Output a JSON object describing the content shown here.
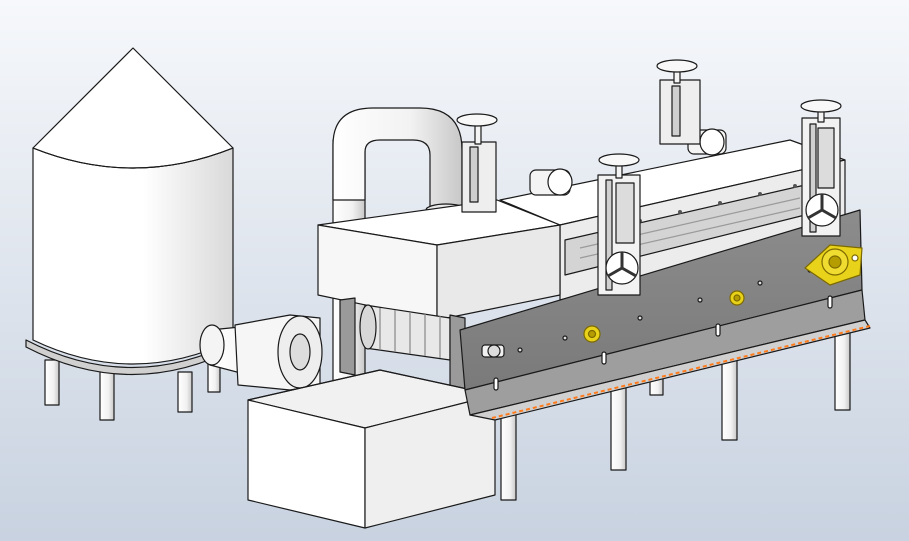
{
  "viewport": {
    "background_top": "#f6f8fb",
    "background_bottom": "#c8d2e0"
  },
  "colors": {
    "outline": "#1a1a1a",
    "white_part": "#ffffff",
    "light_shade": "#e6e6e6",
    "mid_shade": "#cfcfcf",
    "steel_plate": "#8a8a8a",
    "steel_plate_dark": "#6e6e6e",
    "bearing_yellow": "#e8d21a",
    "bearing_yellow_dark": "#b59c00",
    "dash_orange": "#ff7a1a"
  },
  "model": {
    "parts": [
      {
        "name": "silo-hopper",
        "icon": "silo-icon"
      },
      {
        "name": "exhaust-duct",
        "icon": "pipe-icon"
      },
      {
        "name": "fan-housing",
        "icon": "box-icon"
      },
      {
        "name": "drum-roller",
        "icon": "roller-icon"
      },
      {
        "name": "collection-bin",
        "icon": "box-icon"
      },
      {
        "name": "dryer-tunnel",
        "icon": "tunnel-icon"
      },
      {
        "name": "side-frame-plate",
        "icon": "plate-icon"
      },
      {
        "name": "adjustment-handwheels",
        "icon": "handwheel-icon"
      },
      {
        "name": "bearing-units",
        "icon": "bearing-icon"
      },
      {
        "name": "support-legs",
        "icon": "leg-icon"
      }
    ]
  }
}
